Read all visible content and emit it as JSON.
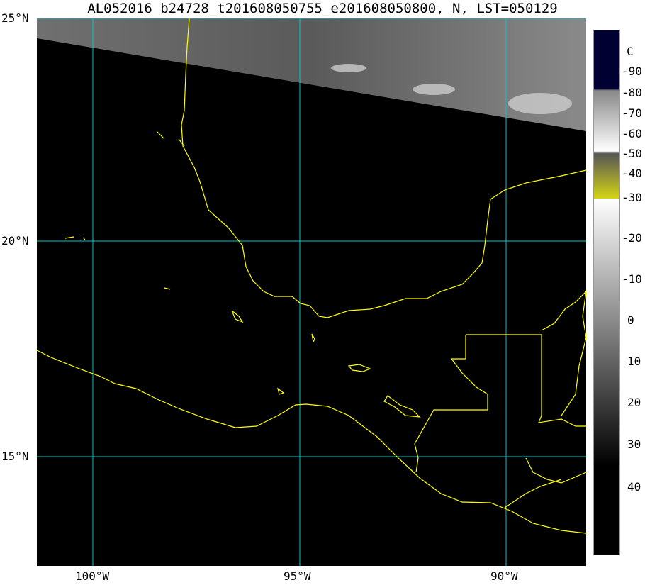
{
  "title": "AL052016 b24728_t201608050755_e201608050800, N, LST=050129",
  "lat_labels": [
    "25°N",
    "20°N",
    "15°N"
  ],
  "lon_labels": [
    "100°W",
    "95°W",
    "90°W"
  ],
  "colorbar": {
    "unit": "C",
    "labels": [
      "-90",
      "-80",
      "-70",
      "-60",
      "-50",
      "-40",
      "-30",
      "-20",
      "-10",
      "0",
      "10",
      "20",
      "30",
      "40"
    ],
    "colors": {
      "coldest": "#000033",
      "yellow": "#ffff00",
      "red": "#ff0000",
      "green": "#00ff00",
      "blue": "#0000ff",
      "cyan": "#aaffff"
    }
  },
  "colors": {
    "coastline": "#ffff00",
    "gridline": "#00c8c8",
    "background": "#000000"
  }
}
